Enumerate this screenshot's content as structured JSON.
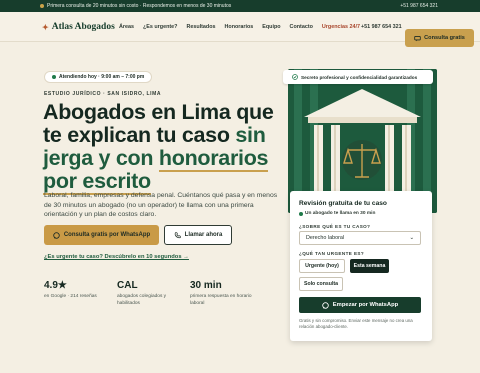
{
  "topbar": {
    "message": "Primera consulta de 20 minutos sin costo · Respondemos en menos de 30 minutos",
    "phone": "+51 987 654 321"
  },
  "nav": {
    "brand": "Atlas Abogados",
    "links": [
      "Áreas",
      "¿Es urgente?",
      "Resultados",
      "Honorarios",
      "Equipo",
      "Contacto",
      "Urgencias 24/7"
    ],
    "phone": "+51 987 654 321",
    "cta": "Consulta gratis"
  },
  "hero": {
    "hours": "Atendiendo hoy · 9:00 am – 7:00 pm",
    "eyebrow": "ESTUDIO JURÍDICO · SAN ISIDRO, LIMA",
    "title_a": "Abogados en Lima que te explican tu caso ",
    "title_hl": "sin jerga y con",
    "title_ul": "honorarios por escrito",
    "lead": "Laboral, familia, empresas y defensa penal. Cuéntanos qué pasa y en menos de 30 minutos un abogado (no un operador) te llama con una primera orientación y un plan de costos claro.",
    "btn_whatsapp": "Consulta gratis por WhatsApp",
    "btn_call": "Llamar ahora",
    "urgent_link": "¿Es urgente tu caso? Descúbrelo en 10 segundos →"
  },
  "stats": [
    {
      "value": "4.9★",
      "label": "en Google · 214 reseñas"
    },
    {
      "value": "CAL",
      "label": "abogados colegiados y habilitados"
    },
    {
      "value": "30 min",
      "label": "primera respuesta en horario laboral"
    }
  ],
  "badge": "Secreto profesional y confidencialidad garantizados",
  "form": {
    "title": "Revisión gratuita de tu caso",
    "sub": "Un abogado te llama en 30 min",
    "q1": "¿SOBRE QUÉ ES TU CASO?",
    "q1_value": "Derecho laboral",
    "q2": "¿QUÉ TAN URGENTE ES?",
    "options": [
      "Urgente (hoy)",
      "Esta semana",
      "Solo consulta"
    ],
    "submit": "Empezar por WhatsApp",
    "fine": "Gratis y sin compromiso. Enviar este mensaje no crea una relación abogado-cliente."
  },
  "colors": {
    "brand_green": "#173d2c",
    "gold": "#c99a46",
    "urgent_red": "#a8462c"
  }
}
